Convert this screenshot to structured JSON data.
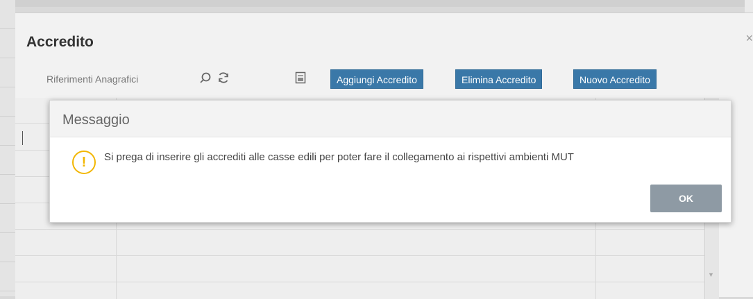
{
  "window": {
    "title": "Accredito",
    "close_glyph": "×",
    "toolbar": {
      "label": "Riferimenti Anagrafici",
      "icons": [
        "search-icon",
        "refresh-icon",
        "export-icon"
      ],
      "buttons": {
        "add": "Aggiungi Accredito",
        "delete": "Elimina Accredito",
        "new": "Nuovo Accredito"
      }
    }
  },
  "dialog": {
    "title": "Messaggio",
    "icon": "warning-icon",
    "icon_glyph": "!",
    "message": "Si prega di inserire gli accrediti alle casse edili per poter fare il collegamento ai rispettivi ambienti MUT",
    "ok_label": "OK"
  },
  "colors": {
    "button_blue": "#3a78a8",
    "ok_button": "#8e9aa4",
    "warning": "#f2b600"
  }
}
